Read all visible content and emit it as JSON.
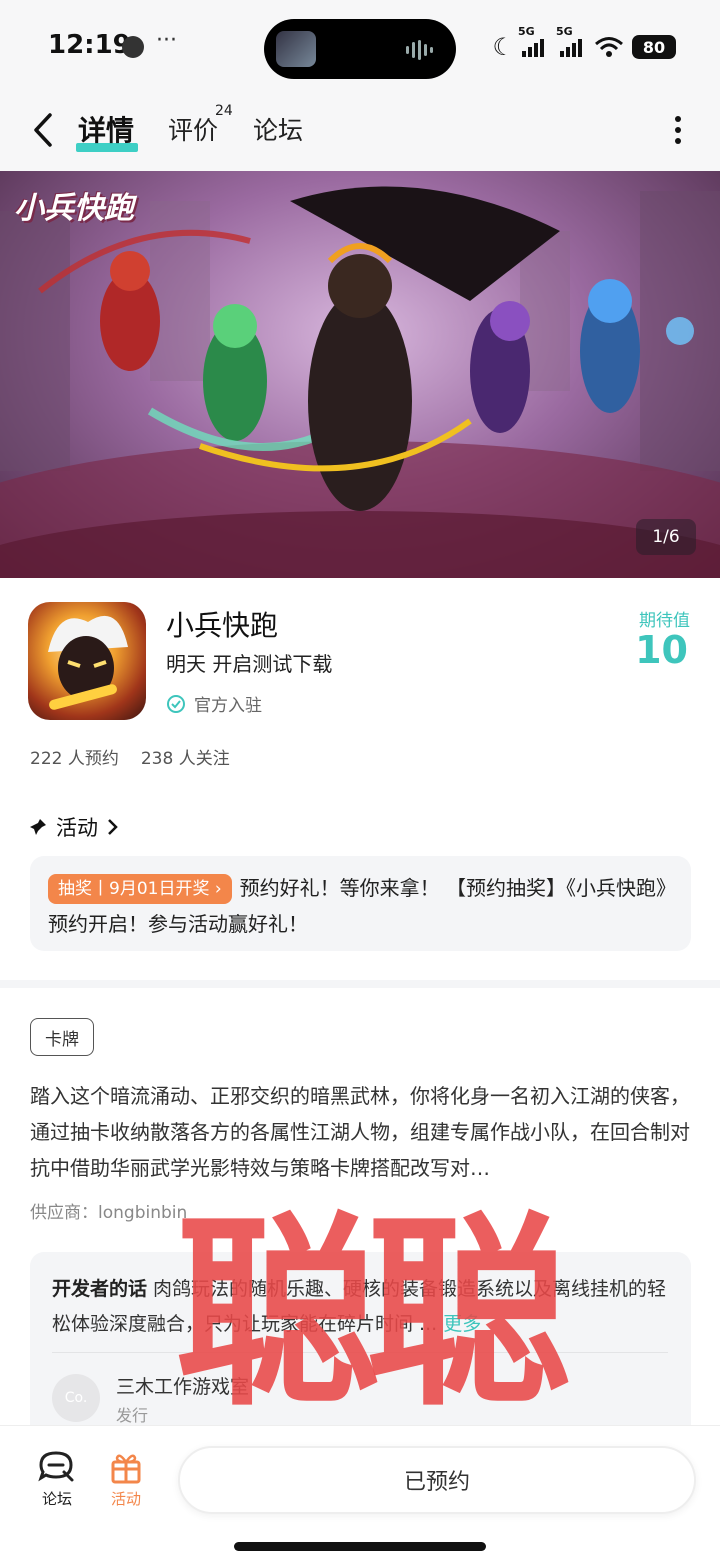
{
  "status_bar": {
    "time": "12:19",
    "network1": "5G",
    "network2": "5G",
    "battery": "80"
  },
  "nav": {
    "tabs": [
      {
        "label": "详情"
      },
      {
        "label": "评价",
        "badge": "24"
      },
      {
        "label": "论坛"
      }
    ]
  },
  "hero": {
    "logo_text": "小兵快跑",
    "counter": "1/6"
  },
  "app": {
    "title": "小兵快跑",
    "subtitle": "明天 开启测试下载",
    "official_label": "官方入驻",
    "expect_label": "期待值",
    "expect_value": "10",
    "reservations": "222 人预约",
    "followers": "238 人关注"
  },
  "activity": {
    "header": "活动",
    "badge": "抽奖丨9月01日开奖 ",
    "text": "预约好礼！等你来拿！ 【预约抽奖】《小兵快跑》预约开启！参与活动赢好礼！"
  },
  "game": {
    "tag": "卡牌",
    "description": "踏入这个暗流涌动、正邪交织的暗黑武林，你将化身一名初入江湖的侠客，通过抽卡收纳散落各方的各属性江湖人物，组建专属作战小队，在回合制对抗中借助华丽武学光影特效与策略卡牌搭配改写对…",
    "supplier": "供应商：longbinbin"
  },
  "developer": {
    "title": "开发者的话",
    "text": "肉鸽玩法的随机乐趣、硬核的装备锻造系统以及离线挂机的轻松体验深度融合，只为让玩家能在碎片时间 ...",
    "more": "更多",
    "avatar": "Co.",
    "name": "三木工作游戏室",
    "role": "发行"
  },
  "watermark": "聪聪",
  "bottom_bar": {
    "forum": "论坛",
    "activity": "活动",
    "reserve_button": "已预约"
  },
  "colors": {
    "accent": "#3ec5bc",
    "orange": "#f3864a",
    "watermark": "#e84848"
  }
}
